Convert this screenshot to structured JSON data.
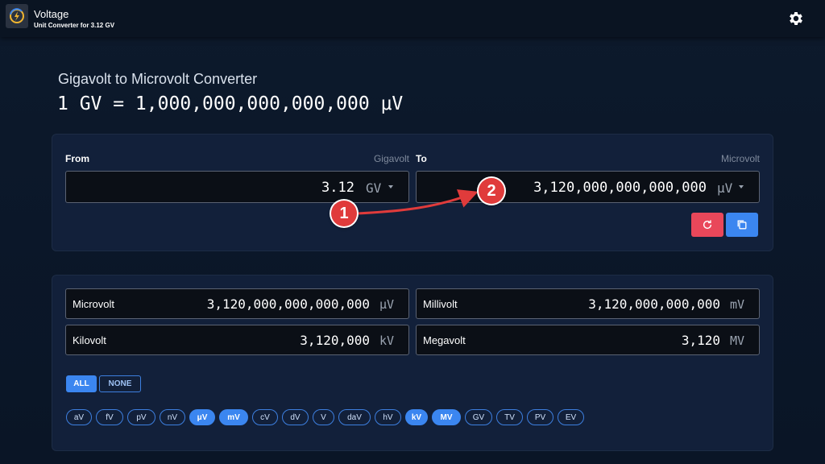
{
  "app": {
    "title": "Voltage",
    "subtitle": "Unit Converter for 3.12 GV",
    "logo_icon": "voltage-logo-icon",
    "settings_icon": "gear-icon"
  },
  "heading": "Gigavolt to Microvolt Converter",
  "formula": "1 GV = 1,000,000,000,000,000 μV",
  "converter": {
    "from_label": "From",
    "from_unit_name": "Gigavolt",
    "from_value": "3.12",
    "from_unit": "GV",
    "to_label": "To",
    "to_unit_name": "Microvolt",
    "to_value": "3,120,000,000,000,000",
    "to_unit": "μV",
    "reset_icon": "refresh-icon",
    "copy_icon": "copy-icon",
    "colors": {
      "reset": "#e9475a",
      "copy": "#3b86f0"
    }
  },
  "results": [
    {
      "name": "Microvolt",
      "value": "3,120,000,000,000,000",
      "unit": "μV"
    },
    {
      "name": "Millivolt",
      "value": "3,120,000,000,000",
      "unit": "mV"
    },
    {
      "name": "Kilovolt",
      "value": "3,120,000",
      "unit": "kV"
    },
    {
      "name": "Megavolt",
      "value": "3,120",
      "unit": "MV"
    }
  ],
  "select": {
    "all_label": "ALL",
    "none_label": "NONE"
  },
  "units": [
    {
      "label": "aV",
      "selected": false
    },
    {
      "label": "fV",
      "selected": false
    },
    {
      "label": "pV",
      "selected": false
    },
    {
      "label": "nV",
      "selected": false
    },
    {
      "label": "μV",
      "selected": true
    },
    {
      "label": "mV",
      "selected": true
    },
    {
      "label": "cV",
      "selected": false
    },
    {
      "label": "dV",
      "selected": false
    },
    {
      "label": "V",
      "selected": false
    },
    {
      "label": "daV",
      "selected": false
    },
    {
      "label": "hV",
      "selected": false
    },
    {
      "label": "kV",
      "selected": true
    },
    {
      "label": "MV",
      "selected": true
    },
    {
      "label": "GV",
      "selected": false
    },
    {
      "label": "TV",
      "selected": false
    },
    {
      "label": "PV",
      "selected": false
    },
    {
      "label": "EV",
      "selected": false
    }
  ],
  "annotations": {
    "marker_1": "1",
    "marker_2": "2",
    "color": "#e03b3b"
  }
}
